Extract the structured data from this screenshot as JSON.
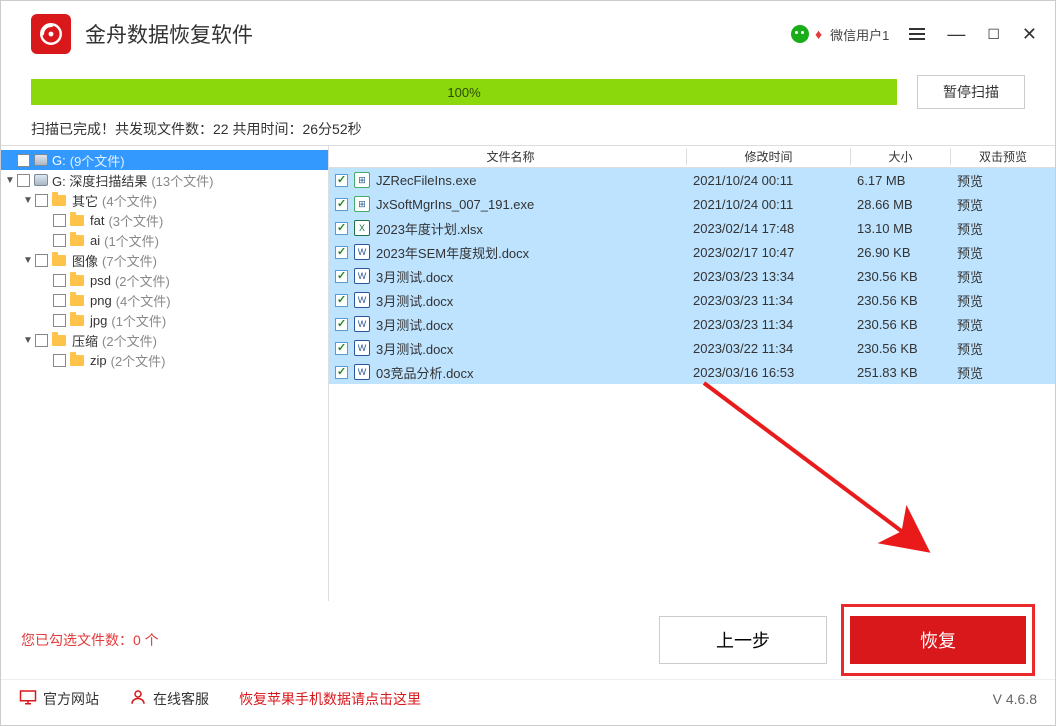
{
  "header": {
    "app_title": "金舟数据恢复软件",
    "user_name": "微信用户1"
  },
  "progress": {
    "percent_text": "100%",
    "fill_percent": 100,
    "pause_button": "暂停扫描",
    "status_text": "扫描已完成！共发现文件数：22  共用时间：26分52秒"
  },
  "sidebar": {
    "items": [
      {
        "indent": 0,
        "expander": "",
        "checked": false,
        "icon": "drive",
        "label": "G:",
        "count": "(9个文件)",
        "selected": true
      },
      {
        "indent": 0,
        "expander": "▼",
        "checked": false,
        "icon": "drive",
        "label": "G: 深度扫描结果",
        "count": "(13个文件)"
      },
      {
        "indent": 1,
        "expander": "▼",
        "checked": false,
        "icon": "folder",
        "label": "其它",
        "count": "(4个文件)"
      },
      {
        "indent": 2,
        "expander": "",
        "checked": false,
        "icon": "folder",
        "label": "fat",
        "count": "(3个文件)"
      },
      {
        "indent": 2,
        "expander": "",
        "checked": false,
        "icon": "folder",
        "label": "ai",
        "count": "(1个文件)"
      },
      {
        "indent": 1,
        "expander": "▼",
        "checked": false,
        "icon": "folder",
        "label": "图像",
        "count": "(7个文件)"
      },
      {
        "indent": 2,
        "expander": "",
        "checked": false,
        "icon": "folder",
        "label": "psd",
        "count": "(2个文件)"
      },
      {
        "indent": 2,
        "expander": "",
        "checked": false,
        "icon": "folder",
        "label": "png",
        "count": "(4个文件)"
      },
      {
        "indent": 2,
        "expander": "",
        "checked": false,
        "icon": "folder",
        "label": "jpg",
        "count": "(1个文件)"
      },
      {
        "indent": 1,
        "expander": "▼",
        "checked": false,
        "icon": "folder",
        "label": "压缩",
        "count": "(2个文件)"
      },
      {
        "indent": 2,
        "expander": "",
        "checked": false,
        "icon": "folder",
        "label": "zip",
        "count": "(2个文件)"
      }
    ]
  },
  "table": {
    "headers": {
      "name": "文件名称",
      "date": "修改时间",
      "size": "大小",
      "preview": "双击预览"
    },
    "rows": [
      {
        "checked": true,
        "type": "exe",
        "name": "JZRecFileIns.exe",
        "date": "2021/10/24 00:11",
        "size": "6.17 MB",
        "preview": "预览"
      },
      {
        "checked": true,
        "type": "exe",
        "name": "JxSoftMgrIns_007_191.exe",
        "date": "2021/10/24 00:11",
        "size": "28.66 MB",
        "preview": "预览"
      },
      {
        "checked": true,
        "type": "xlsx",
        "name": "2023年度计划.xlsx",
        "date": "2023/02/14 17:48",
        "size": "13.10 MB",
        "preview": "预览"
      },
      {
        "checked": true,
        "type": "docx",
        "name": "2023年SEM年度规划.docx",
        "date": "2023/02/17 10:47",
        "size": "26.90 KB",
        "preview": "预览"
      },
      {
        "checked": true,
        "type": "docx",
        "name": "3月测试.docx",
        "date": "2023/03/23 13:34",
        "size": "230.56 KB",
        "preview": "预览"
      },
      {
        "checked": true,
        "type": "docx",
        "name": "3月测试.docx",
        "date": "2023/03/23 11:34",
        "size": "230.56 KB",
        "preview": "预览"
      },
      {
        "checked": true,
        "type": "docx",
        "name": "3月测试.docx",
        "date": "2023/03/23 11:34",
        "size": "230.56 KB",
        "preview": "预览"
      },
      {
        "checked": true,
        "type": "docx",
        "name": "3月测试.docx",
        "date": "2023/03/22 11:34",
        "size": "230.56 KB",
        "preview": "预览"
      },
      {
        "checked": true,
        "type": "docx",
        "name": "03竞品分析.docx",
        "date": "2023/03/16 16:53",
        "size": "251.83 KB",
        "preview": "预览"
      }
    ]
  },
  "action": {
    "selected_text": "您已勾选文件数：0 个",
    "prev_button": "上一步",
    "recover_button": "恢复"
  },
  "footer": {
    "official_site": "官方网站",
    "support": "在线客服",
    "promo": "恢复苹果手机数据请点击这里",
    "version": "V 4.6.8"
  }
}
